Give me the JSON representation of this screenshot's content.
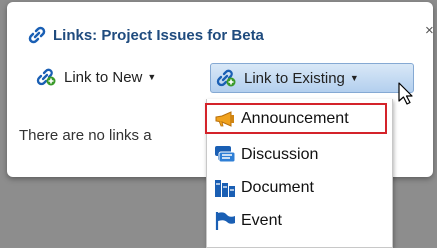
{
  "dialog": {
    "title": "Links: Project Issues for Beta",
    "close_symbol": "×",
    "empty_message": "There are no links a"
  },
  "toolbar": {
    "link_new_label": "Link to New",
    "link_existing_label": "Link to Existing",
    "caret": "▼"
  },
  "menu": {
    "items": [
      {
        "label": "Announcement",
        "icon": "megaphone-icon",
        "highlighted": true
      },
      {
        "label": "Discussion",
        "icon": "chat-bubbles-icon",
        "highlighted": false
      },
      {
        "label": "Document",
        "icon": "document-icon",
        "highlighted": false
      },
      {
        "label": "Event",
        "icon": "flag-icon",
        "highlighted": false
      }
    ]
  },
  "colors": {
    "title": "#1f4b7e",
    "highlight_border": "#d4232a",
    "backdrop": "#8d8d8d",
    "button_bg": "#c5dcf3",
    "icon_blue": "#1a5fb4"
  }
}
